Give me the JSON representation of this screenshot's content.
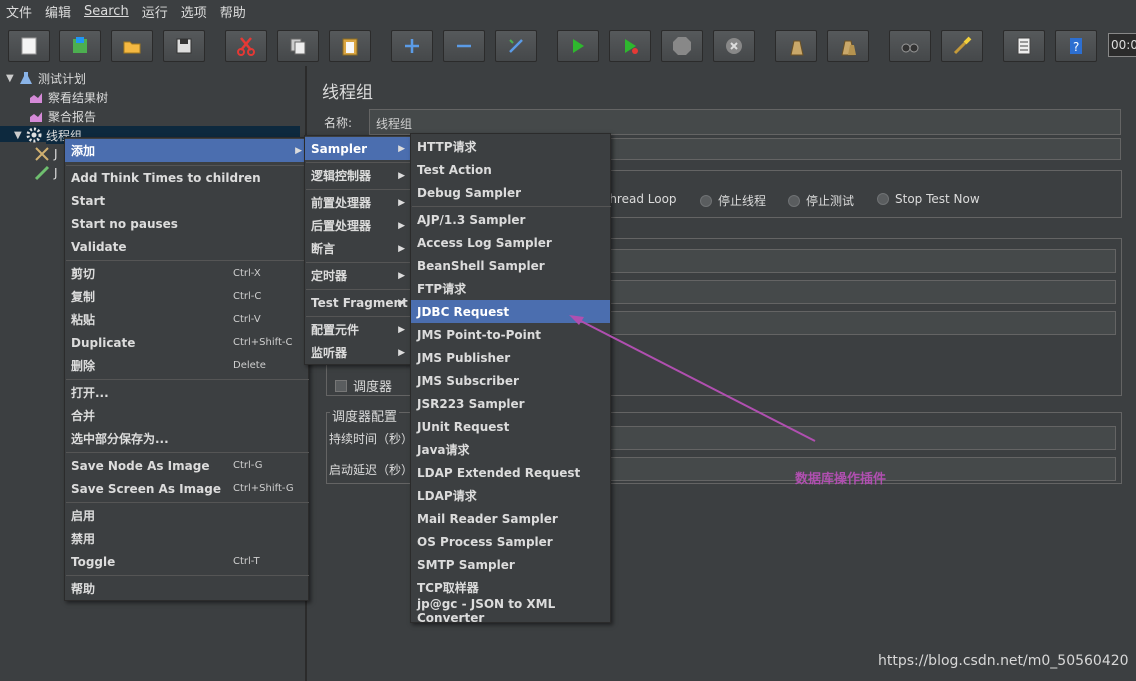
{
  "menubar": {
    "items": [
      "文件",
      "编辑",
      "Search",
      "运行",
      "选项",
      "帮助"
    ]
  },
  "toolbar": {
    "buttons": [
      "new-icon",
      "templates-icon",
      "open-icon",
      "save-icon",
      "cut-icon",
      "copy-icon",
      "paste-icon",
      "expand-icon",
      "collapse-icon",
      "toggle-icon",
      "start-icon",
      "start-no-pause-icon",
      "stop-icon",
      "shutdown-icon",
      "clear-icon",
      "clear-all-icon",
      "search-icon",
      "reset-search-icon",
      "function-helper-icon",
      "help-icon"
    ],
    "timer": "00:0"
  },
  "tree": {
    "nodes": [
      {
        "label": "测试计划",
        "icon": "flask-icon"
      },
      {
        "label": "察看结果树",
        "icon": "chart-icon"
      },
      {
        "label": "聚合报告",
        "icon": "chart-icon"
      },
      {
        "label": "线程组",
        "icon": "gear-icon"
      },
      {
        "label": "J",
        "icon": "tools-icon"
      },
      {
        "label": "J",
        "icon": "pen-icon"
      }
    ]
  },
  "panel": {
    "title": "线程组",
    "name_label": "名称:",
    "name_value": "线程组",
    "radios": [
      "Thread Loop",
      "停止线程",
      "停止测试",
      "Stop Test Now"
    ],
    "scheduler_checkbox": "调度器",
    "scheduler_legend": "调度器配置",
    "duration_label": "持续时间（秒）",
    "delay_label": "启动延迟（秒）"
  },
  "context_menu": {
    "items": [
      {
        "label": "添加",
        "accel": "",
        "submenu": true
      },
      {
        "label": "Add Think Times to children",
        "accel": ""
      },
      {
        "label": "Start",
        "accel": ""
      },
      {
        "label": "Start no pauses",
        "accel": ""
      },
      {
        "label": "Validate",
        "accel": ""
      },
      {
        "label": "剪切",
        "accel": "Ctrl-X"
      },
      {
        "label": "复制",
        "accel": "Ctrl-C"
      },
      {
        "label": "粘贴",
        "accel": "Ctrl-V"
      },
      {
        "label": "Duplicate",
        "accel": "Ctrl+Shift-C"
      },
      {
        "label": "删除",
        "accel": "Delete"
      },
      {
        "label": "打开...",
        "accel": ""
      },
      {
        "label": "合并",
        "accel": ""
      },
      {
        "label": "选中部分保存为...",
        "accel": ""
      },
      {
        "label": "Save Node As Image",
        "accel": "Ctrl-G"
      },
      {
        "label": "Save Screen As Image",
        "accel": "Ctrl+Shift-G"
      },
      {
        "label": "启用",
        "accel": ""
      },
      {
        "label": "禁用",
        "accel": ""
      },
      {
        "label": "Toggle",
        "accel": "Ctrl-T"
      },
      {
        "label": "帮助",
        "accel": ""
      }
    ]
  },
  "add_submenu": {
    "items": [
      "Sampler",
      "逻辑控制器",
      "前置处理器",
      "后置处理器",
      "断言",
      "定时器",
      "Test Fragment",
      "配置元件",
      "监听器"
    ]
  },
  "sampler_submenu": {
    "items": [
      "HTTP请求",
      "Test Action",
      "Debug Sampler",
      "AJP/1.3 Sampler",
      "Access Log Sampler",
      "BeanShell Sampler",
      "FTP请求",
      "JDBC Request",
      "JMS Point-to-Point",
      "JMS Publisher",
      "JMS Subscriber",
      "JSR223 Sampler",
      "JUnit Request",
      "Java请求",
      "LDAP Extended Request",
      "LDAP请求",
      "Mail Reader Sampler",
      "OS Process Sampler",
      "SMTP Sampler",
      "TCP取样器",
      "jp@gc - JSON to XML Converter"
    ],
    "highlighted": "JDBC Request"
  },
  "annotation": {
    "text": "数据库操作插件",
    "color": "#b04fb0"
  },
  "watermark": "https://blog.csdn.net/m0_50560420"
}
